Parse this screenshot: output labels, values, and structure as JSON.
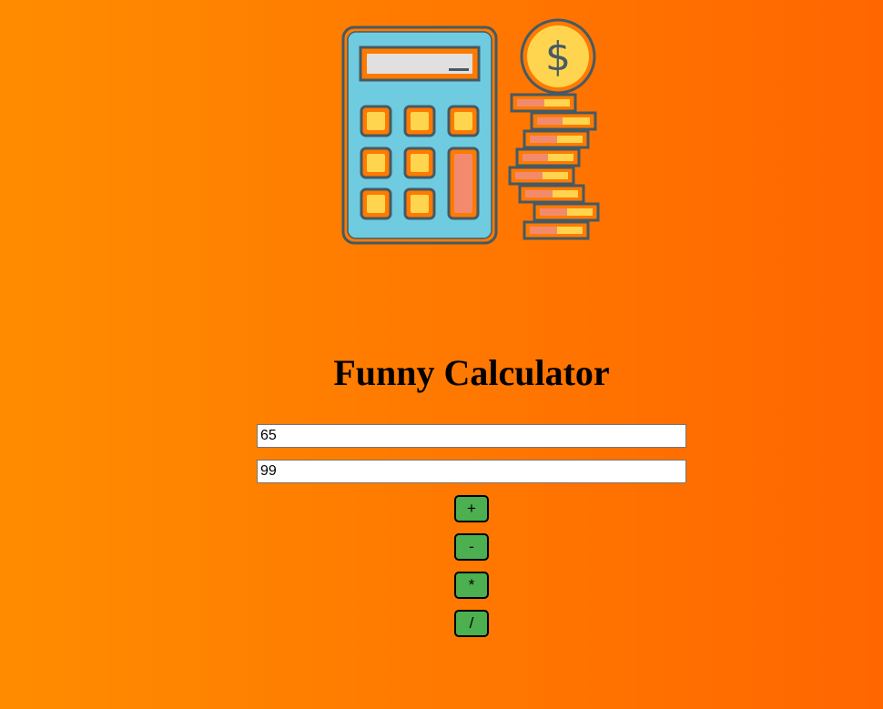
{
  "colors": {
    "background_start": "#ff8c00",
    "background_end": "#ff6600",
    "button": "#4caf50",
    "calculator_body": "#6ecbe0",
    "calculator_key": "#ffd54f",
    "coin": "#ffd54f",
    "outline": "#455a64"
  },
  "hero": {
    "icon": "calculator-with-coins-illustration",
    "coin_symbol": "$"
  },
  "title": "Funny Calculator",
  "inputs": [
    {
      "value": "65"
    },
    {
      "value": "99"
    }
  ],
  "buttons": {
    "add": "+",
    "subtract": "-",
    "multiply": "*",
    "divide": "/"
  }
}
